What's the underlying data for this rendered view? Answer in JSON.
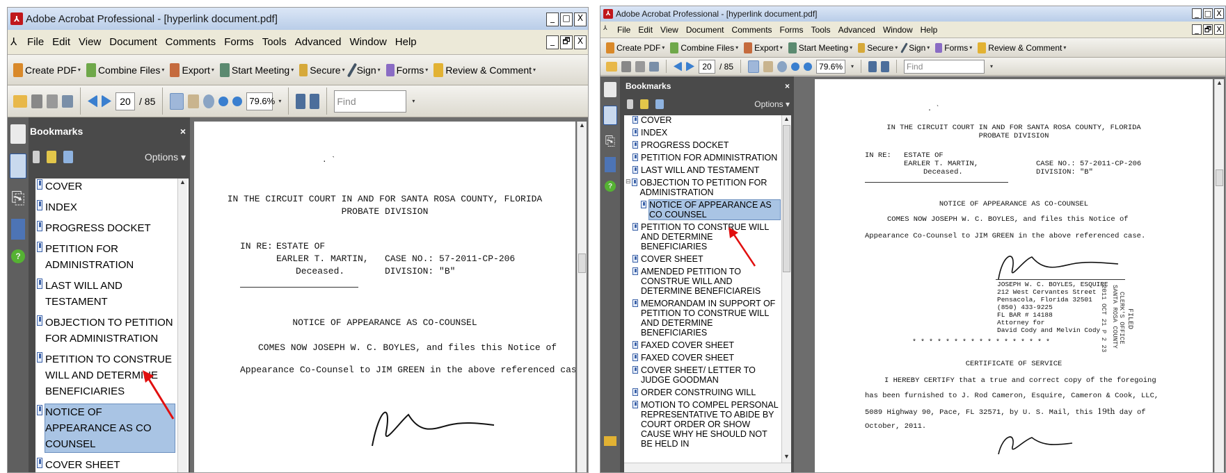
{
  "window": {
    "title": "Adobe Acrobat Professional - [hyperlink document.pdf]",
    "controls": {
      "minimize": "_",
      "restore": "□",
      "close": "X"
    },
    "doc_controls": {
      "minimize": "_",
      "restore": "🗗",
      "close": "X"
    }
  },
  "menu": [
    "File",
    "Edit",
    "View",
    "Document",
    "Comments",
    "Forms",
    "Tools",
    "Advanced",
    "Window",
    "Help"
  ],
  "task_toolbar": {
    "create_pdf": "Create PDF",
    "combine_files": "Combine Files",
    "export": "Export",
    "start_meeting": "Start Meeting",
    "secure": "Secure",
    "sign": "Sign",
    "forms": "Forms",
    "review_comment": "Review & Comment"
  },
  "nav_toolbar": {
    "page_current": "20",
    "page_total": "/ 85",
    "zoom": "79.6%",
    "find_placeholder": "Find"
  },
  "bookmarks_panel": {
    "title": "Bookmarks",
    "close": "×",
    "options": "Options"
  },
  "left_bookmarks": [
    "COVER",
    "INDEX",
    "PROGRESS DOCKET",
    "PETITION FOR ADMINISTRATION",
    "LAST WILL AND TESTAMENT",
    "OBJECTION TO PETITION FOR ADMINISTRATION",
    "PETITION TO CONSTRUE WILL AND DETERMINE BENEFICIARIES",
    "NOTICE OF APPEARANCE AS CO COUNSEL",
    "COVER SHEET"
  ],
  "right_bookmarks": [
    "COVER",
    "INDEX",
    "PROGRESS DOCKET",
    "PETITION FOR ADMINISTRATION",
    "LAST WILL AND TESTAMENT",
    "OBJECTION TO PETITION FOR ADMINISTRATION",
    "NOTICE OF APPEARANCE AS CO COUNSEL",
    "PETITION TO CONSTRUE WILL AND DETERMINE BENEFICIARIES",
    "COVER SHEET",
    "AMENDED PETITION TO CONSTRUE WILL AND DETERMINE BENEFICIAREIS",
    "MEMORANDAM IN SUPPORT OF PETITION TO CONSTRUE WILL AND DETERMINE BENEFICIARIES",
    "FAXED COVER SHEET",
    "FAXED COVER SHEET",
    "COVER SHEET/ LETTER TO JUDGE GOODMAN",
    "ORDER CONSTRUING WILL",
    "MOTION TO COMPEL PERSONAL REPRESENTATIVE TO ABIDE BY COURT ORDER OR SHOW CAUSE WHY HE SHOULD NOT BE HELD IN"
  ],
  "document": {
    "court_line1": "IN THE CIRCUIT COURT IN AND FOR SANTA ROSA COUNTY, FLORIDA",
    "court_line2": "PROBATE DIVISION",
    "in_re": "IN RE:",
    "estate_of": "ESTATE OF",
    "name": "EARLER T. MARTIN,",
    "deceased": "Deceased.",
    "case_no": "CASE NO.: 57-2011-CP-206",
    "division": "DIVISION: \"B\"",
    "notice_title": "NOTICE OF APPEARANCE AS CO-COUNSEL",
    "body_line1": "COMES NOW JOSEPH W. C. BOYLES, and files this Notice of",
    "body_line2": "Appearance Co-Counsel to JIM GREEN in the above referenced case.",
    "sig_name": "JOSEPH W. C. BOYLES, ESQUIRE",
    "sig_addr1": "212 West Cervantes Street",
    "sig_addr2": "Pensacola, Florida  32501",
    "sig_phone": "(850) 433-9225",
    "sig_bar": "FL BAR # 14188",
    "sig_attorney_for": "Attorney for",
    "sig_clients": "David Cody and Melvin Cody",
    "stars": "* * * * * * * * * * * * * * * * *",
    "cert_title": "CERTIFICATE OF SERVICE",
    "cert_line1": "I HEREBY CERTIFY that a true and correct copy of the foregoing",
    "cert_line2": "has been furnished to J. Rod Cameron, Esquire, Cameron & Cook, LLC,",
    "cert_line3": "5089 Highway 90, Pace, FL 32571, by U. S. Mail, this",
    "cert_day": "19th",
    "cert_line3_end": "day of",
    "cert_line4": "October, 2011.",
    "stamp_filed": "FILED",
    "stamp_county": "SANTA ROSA COUNTY",
    "stamp_clerk": "CLERK'S OFFICE",
    "stamp_date": "2011 OCT 21  P 2 23"
  }
}
